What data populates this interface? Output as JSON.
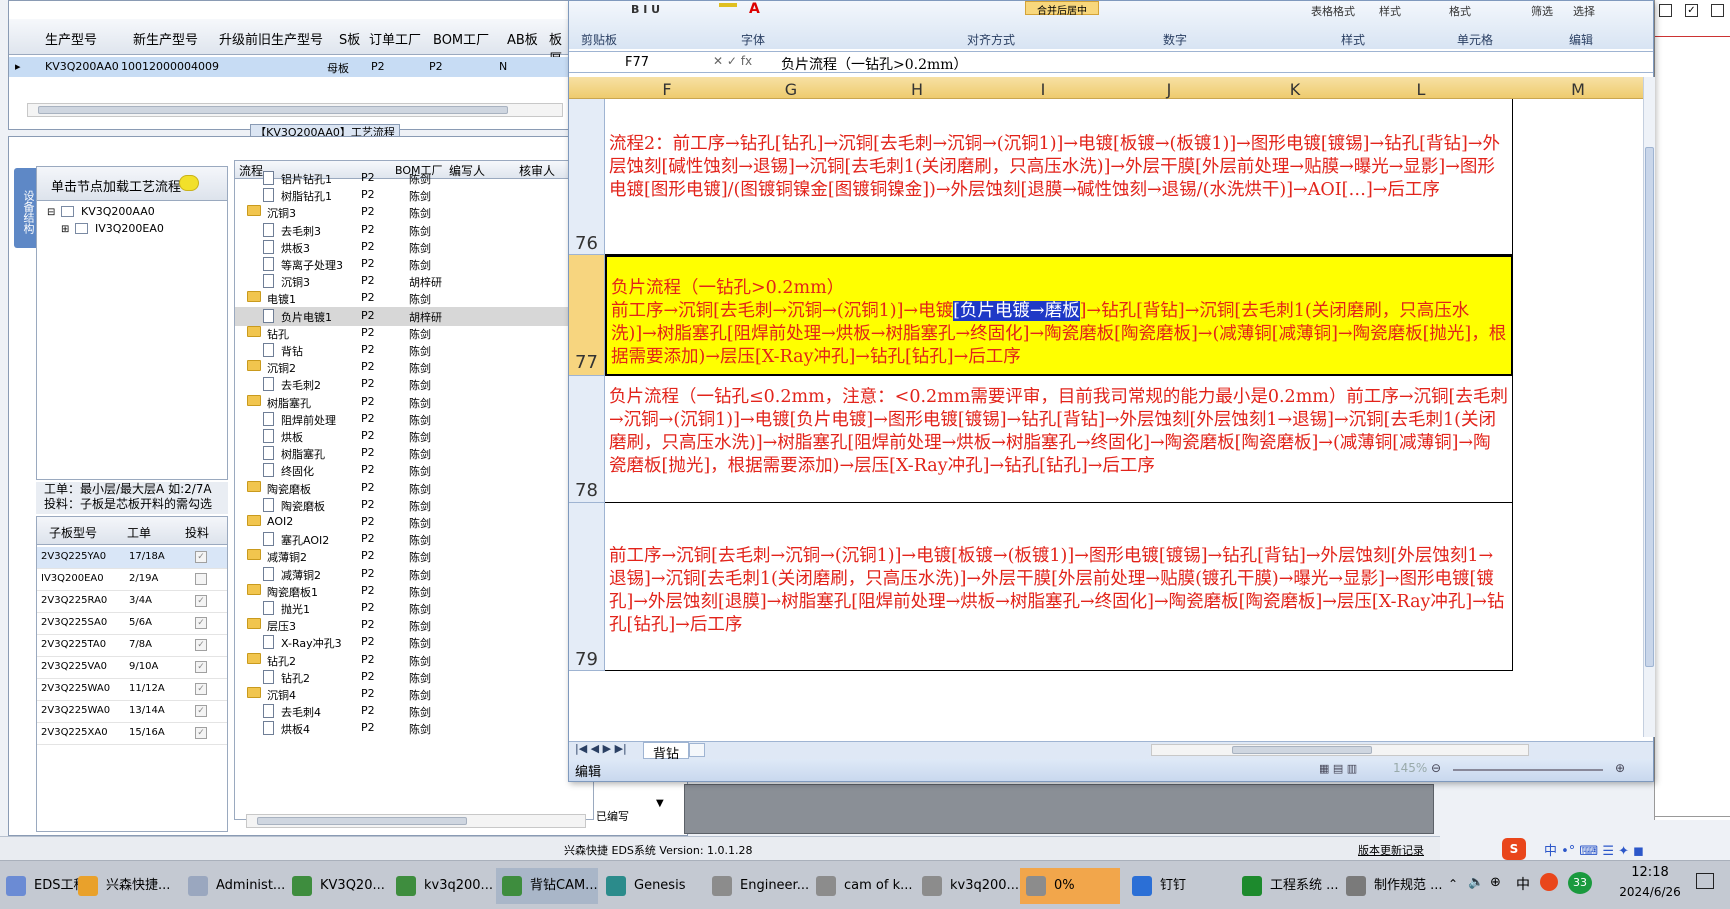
{
  "top_grid": {
    "headers": [
      "生产型号",
      "新生产型号",
      "升级前旧生产型号",
      "S板",
      "订单工厂",
      "BOM工厂",
      "AB板",
      "板厚"
    ],
    "row": [
      "KV3Q200AA0",
      "10012000004009",
      "",
      "母板",
      "P2",
      "P2",
      "N",
      ""
    ]
  },
  "left_panel": {
    "side_tab": "设备结构",
    "node_header": "单击节点加载工艺流程",
    "tree_root": "KV3Q200AA0",
    "tree_child": "IV3Q200EA0",
    "info_line1": "工单：最小层/最大层A 如:2/7A",
    "info_line2": "投料：子板是芯板开料的需勾选",
    "sub_headers": [
      "子板型号",
      "工单",
      "投料"
    ],
    "sub_rows": [
      {
        "model": "2V3Q225YA0",
        "order": "17/18A",
        "feed": true
      },
      {
        "model": "IV3Q200EA0",
        "order": "2/19A",
        "feed": false
      },
      {
        "model": "2V3Q225RA0",
        "order": "3/4A",
        "feed": true
      },
      {
        "model": "2V3Q225SA0",
        "order": "5/6A",
        "feed": true
      },
      {
        "model": "2V3Q225TA0",
        "order": "7/8A",
        "feed": true
      },
      {
        "model": "2V3Q225VA0",
        "order": "9/10A",
        "feed": true
      },
      {
        "model": "2V3Q225WA0",
        "order": "11/12A",
        "feed": true
      },
      {
        "model": "2V3Q225WA0",
        "order": "13/14A",
        "feed": true
      },
      {
        "model": "2V3Q225XA0",
        "order": "15/16A",
        "feed": true
      }
    ]
  },
  "process_tab": "【KV3Q200AA0】工艺流程",
  "process_tree": {
    "headers": [
      "流程",
      "BOM工厂",
      "编写人",
      "核审人"
    ],
    "rows": [
      {
        "name": "铝片钻孔1",
        "type": "doc",
        "bom": "P2",
        "writer": "陈剑"
      },
      {
        "name": "树脂钻孔1",
        "type": "doc",
        "bom": "P2",
        "writer": "陈剑"
      },
      {
        "name": "沉铜3",
        "type": "folder",
        "bom": "P2",
        "writer": "陈剑"
      },
      {
        "name": "去毛刺3",
        "type": "doc",
        "bom": "P2",
        "writer": "陈剑"
      },
      {
        "name": "烘板3",
        "type": "doc",
        "bom": "P2",
        "writer": "陈剑"
      },
      {
        "name": "等离子处理3",
        "type": "doc",
        "bom": "P2",
        "writer": "陈剑"
      },
      {
        "name": "沉铜3",
        "type": "doc",
        "bom": "P2",
        "writer": "胡梓研"
      },
      {
        "name": "电镀1",
        "type": "folder",
        "bom": "P2",
        "writer": "陈剑"
      },
      {
        "name": "负片电镀1",
        "type": "doc",
        "bom": "P2",
        "writer": "胡梓研",
        "selected": true
      },
      {
        "name": "钻孔",
        "type": "folder",
        "bom": "P2",
        "writer": "陈剑"
      },
      {
        "name": "背钻",
        "type": "doc",
        "bom": "P2",
        "writer": "陈剑"
      },
      {
        "name": "沉铜2",
        "type": "folder",
        "bom": "P2",
        "writer": "陈剑"
      },
      {
        "name": "去毛刺2",
        "type": "doc",
        "bom": "P2",
        "writer": "陈剑"
      },
      {
        "name": "树脂塞孔",
        "type": "folder",
        "bom": "P2",
        "writer": "陈剑"
      },
      {
        "name": "阻焊前处理",
        "type": "doc",
        "bom": "P2",
        "writer": "陈剑"
      },
      {
        "name": "烘板",
        "type": "doc",
        "bom": "P2",
        "writer": "陈剑"
      },
      {
        "name": "树脂塞孔",
        "type": "doc",
        "bom": "P2",
        "writer": "陈剑"
      },
      {
        "name": "终固化",
        "type": "doc",
        "bom": "P2",
        "writer": "陈剑"
      },
      {
        "name": "陶瓷磨板",
        "type": "folder",
        "bom": "P2",
        "writer": "陈剑"
      },
      {
        "name": "陶瓷磨板",
        "type": "doc",
        "bom": "P2",
        "writer": "陈剑"
      },
      {
        "name": "AOI2",
        "type": "folder",
        "bom": "P2",
        "writer": "陈剑"
      },
      {
        "name": "塞孔AOI2",
        "type": "doc",
        "bom": "P2",
        "writer": "陈剑"
      },
      {
        "name": "减薄铜2",
        "type": "folder",
        "bom": "P2",
        "writer": "陈剑"
      },
      {
        "name": "减薄铜2",
        "type": "doc",
        "bom": "P2",
        "writer": "陈剑"
      },
      {
        "name": "陶瓷磨板1",
        "type": "folder",
        "bom": "P2",
        "writer": "陈剑"
      },
      {
        "name": "抛光1",
        "type": "doc",
        "bom": "P2",
        "writer": "陈剑"
      },
      {
        "name": "层压3",
        "type": "folder",
        "bom": "P2",
        "writer": "陈剑"
      },
      {
        "name": "X-Ray冲孔3",
        "type": "doc",
        "bom": "P2",
        "writer": "陈剑"
      },
      {
        "name": "钻孔2",
        "type": "folder",
        "bom": "P2",
        "writer": "陈剑"
      },
      {
        "name": "钻孔2",
        "type": "doc",
        "bom": "P2",
        "writer": "陈剑"
      },
      {
        "name": "沉铜4",
        "type": "folder",
        "bom": "P2",
        "writer": "陈剑"
      },
      {
        "name": "去毛刺4",
        "type": "doc",
        "bom": "P2",
        "writer": "陈剑"
      },
      {
        "name": "烘板4",
        "type": "doc",
        "bom": "P2",
        "writer": "陈剑"
      }
    ],
    "status_label": "已编写"
  },
  "app_status": {
    "center": "兴森快捷 EDS系统 Version: 1.0.1.28",
    "right": "版本更新记录"
  },
  "excel": {
    "ribbon_groups": [
      "剪贴板",
      "字体",
      "对齐方式",
      "数字",
      "样式",
      "单元格",
      "编辑"
    ],
    "ribbon_items": [
      "合并后居中",
      "表格格式",
      "样式",
      "格式",
      "筛选",
      "选择"
    ],
    "name_box": "F77",
    "formula": "负片流程（一钻孔>0.2mm）",
    "columns": [
      "F",
      "G",
      "H",
      "I",
      "J",
      "K",
      "L",
      "M"
    ],
    "rows": [
      {
        "num": "76",
        "text": "流程2：前工序→钻孔[钻孔]→沉铜[去毛刺→沉铜→(沉铜1)]→电镀[板镀→(板镀1)]→图形电镀[镀锡]→钻孔[背钻]→外层蚀刻[碱性蚀刻→退锡]→沉铜[去毛刺1(关闭磨刷，只高压水洗)]→外层干膜[外层前处理→贴膜→曝光→显影]→图形电镀[图形电镀]/(图镀铜镍金[图镀铜镍金])→外层蚀刻[退膜→碱性蚀刻→退锡/(水洗烘干)]→AOI[…]→后工序"
      },
      {
        "num": "77",
        "line1": "负片流程（一钻孔>0.2mm）",
        "pre": "前工序→沉铜[去毛刺→沉铜→(沉铜1)]→电镀",
        "sel": "[负片电镀→磨板",
        "post": "]→钻孔[背钻]→沉铜[去毛刺1(关闭磨刷，只高压水洗)]→树脂塞孔[阻焊前处理→烘板→树脂塞孔→终固化]→陶瓷磨板[陶瓷磨板]→(减薄铜[减薄铜]→陶瓷磨板[抛光]，根据需要添加)→层压[X-Ray冲孔]→钻孔[钻孔]→后工序"
      },
      {
        "num": "78",
        "text": "负片流程（一钻孔≤0.2mm，注意：<0.2mm需要评审，目前我司常规的能力最小是0.2mm）前工序→沉铜[去毛刺→沉铜→(沉铜1)]→电镀[负片电镀]→图形电镀[镀锡]→钻孔[背钻]→外层蚀刻[外层蚀刻1→退锡]→沉铜[去毛刺1(关闭磨刷，只高压水洗)]→树脂塞孔[阻焊前处理→烘板→树脂塞孔→终固化]→陶瓷磨板[陶瓷磨板]→(减薄铜[减薄铜]→陶瓷磨板[抛光]，根据需要添加)→层压[X-Ray冲孔]→钻孔[钻孔]→后工序"
      },
      {
        "num": "79",
        "text": "前工序→沉铜[去毛刺→沉铜→(沉铜1)]→电镀[板镀→(板镀1)]→图形电镀[镀锡]→钻孔[背钻]→外层蚀刻[外层蚀刻1→退锡]→沉铜[去毛刺1(关闭磨刷，只高压水洗)]→外层干膜[外层前处理→贴膜(镀孔干膜)→曝光→显影]→图形电镀[镀孔]→外层蚀刻[退膜]→树脂塞孔[阻焊前处理→烘板→树脂塞孔→终固化]→陶瓷磨板[陶瓷磨板]→层压[X-Ray冲孔]→钻孔[钻孔]→后工序"
      }
    ],
    "sheet_tab": "背钻",
    "status": "编辑",
    "zoom": "145%"
  },
  "taskbar": {
    "items": [
      "EDS工程...",
      "兴森快捷...",
      "Administ...",
      "KV3Q20...",
      "kv3q200...",
      "背钻CAM...",
      "Genesis",
      "Engineer...",
      "cam of k...",
      "kv3q200...",
      "0%",
      "钉钉",
      "工程系统 ...",
      "制作规范 ..."
    ],
    "tray_lang": "中",
    "time": "12:18",
    "date": "2024/6/26",
    "badge": "33"
  }
}
